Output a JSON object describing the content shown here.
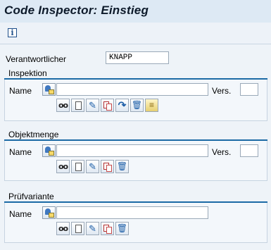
{
  "window": {
    "title": "Code Inspector: Einstieg"
  },
  "toolbar": {
    "info_icon": "info-icon"
  },
  "responsible": {
    "label": "Verantwortlicher",
    "value": "KNAPP"
  },
  "inspection": {
    "title": "Inspektion",
    "name_label": "Name",
    "name_value": "",
    "version_label": "Vers.",
    "version_value": ""
  },
  "object_set": {
    "title": "Objektmenge",
    "name_label": "Name",
    "name_value": "",
    "version_label": "Vers.",
    "version_value": ""
  },
  "check_variant": {
    "title": "Prüfvariante",
    "name_label": "Name",
    "name_value": ""
  },
  "icons": {
    "glasses": "display-icon",
    "doc": "create-icon",
    "pencil": "change-icon",
    "copy": "copy-icon",
    "redo": "execute-icon",
    "trash": "delete-icon",
    "scroll": "results-icon"
  }
}
